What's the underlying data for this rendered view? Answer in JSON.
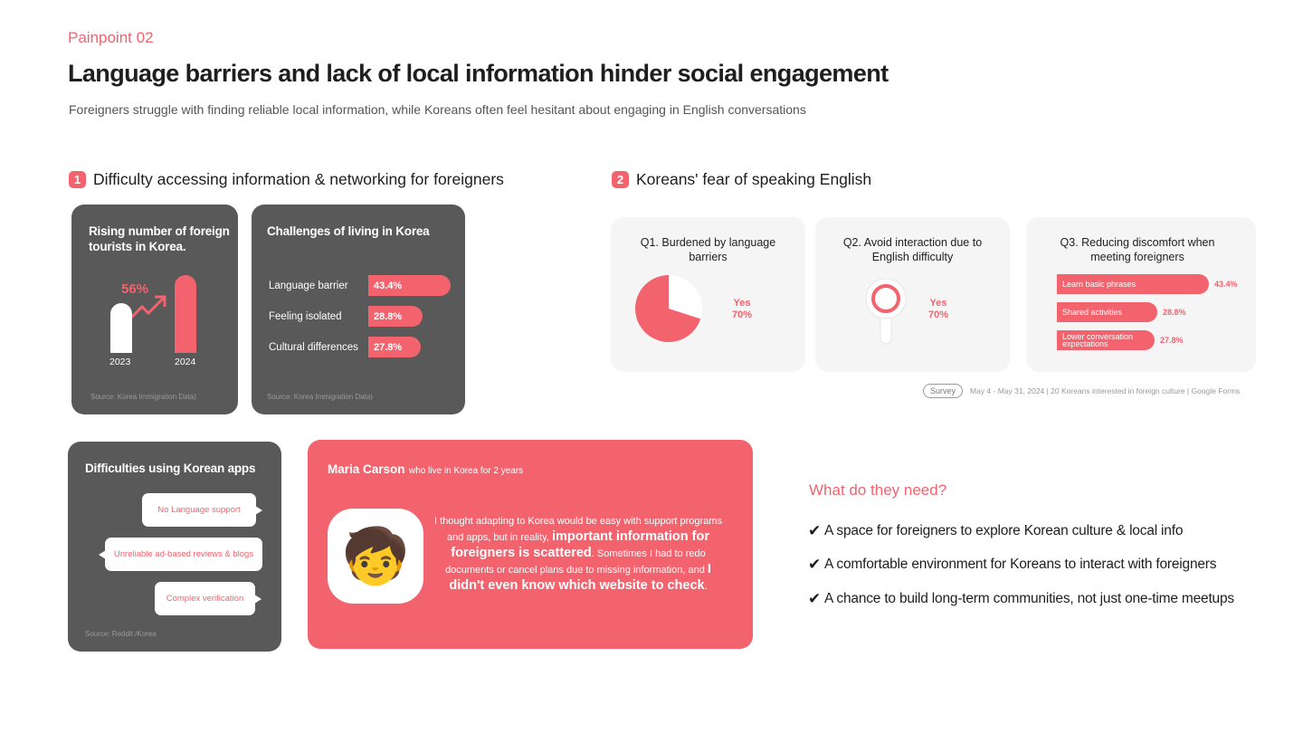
{
  "header": {
    "eyebrow": "Painpoint 02",
    "title": "Language barriers and lack of local information hinder social engagement",
    "subtitle": "Foreigners struggle with finding reliable local information, while Koreans often feel hesitant about engaging in English conversations"
  },
  "section1": {
    "number": "1",
    "title": "Difficulty accessing information & networking for foreigners",
    "tourists": {
      "title": "Rising number of foreign tourists in Korea.",
      "growth": "56%",
      "bars": [
        {
          "year": "2023",
          "value": 1.0
        },
        {
          "year": "2024",
          "value": 1.56
        }
      ],
      "source": "Source: Korea Immigration Data)"
    },
    "challenges": {
      "title": "Challenges of living in Korea",
      "rows": [
        {
          "label": "Language barrier",
          "pct": "43.4%",
          "value": 43.4
        },
        {
          "label": "Feeling isolated",
          "pct": "28.8%",
          "value": 28.8
        },
        {
          "label": "Cultural differences",
          "pct": "27.8%",
          "value": 27.8
        }
      ],
      "source": "Source: Korea Immigration Data)"
    }
  },
  "section2": {
    "number": "2",
    "title": "Koreans' fear of speaking English",
    "q1": {
      "title": "Q1. Burdened by language barriers",
      "yes_label": "Yes",
      "yes_pct": "70%",
      "value": 70
    },
    "q2": {
      "title": "Q2. Avoid interaction due to English difficulty",
      "yes_label": "Yes",
      "yes_pct": "70%",
      "value": 70
    },
    "q3": {
      "title": "Q3. Reducing discomfort when meeting foreigners",
      "rows": [
        {
          "label": "Learn basic phrases",
          "pct": "43.4%",
          "value": 43.4
        },
        {
          "label": "Shared activities",
          "pct": "28.8%",
          "value": 28.8
        },
        {
          "label": "Lower conversation expectations",
          "pct": "27.8%",
          "value": 27.8
        }
      ]
    },
    "survey_tag": "Survey",
    "survey_note": "May 4 - May 31, 2024 | 20 Koreans interested in foreign culture | Google Forms"
  },
  "apps": {
    "title": "Difficulties using Korean apps",
    "bubbles": [
      "No Language support",
      "Unreliable ad-based reviews & blogs",
      "Complex verification"
    ],
    "source": "Source: Reddit /Korea"
  },
  "quote": {
    "name": "Maria Carson",
    "role": "who live in Korea for 2 years",
    "avatar": "🧒",
    "p1": "I thought adapting to Korea would be easy with support programs and apps, but in reality,",
    "b1": "important information for foreigners is scattered",
    "p2": ". Sometimes I had to redo documents or cancel plans due to missing information, and",
    "b2": "I didn't even know which website to check",
    "p3": "."
  },
  "needs": {
    "title": "What do they need?",
    "check": "✔",
    "items": [
      "A space for foreigners to explore Korean culture & local info",
      "A comfortable environment for Koreans to interact with foreigners",
      "A chance to build long-term communities, not just one-time meetups"
    ]
  },
  "colors": {
    "accent": "#f2636e",
    "dark_card": "#595959",
    "light_card": "#f5f5f5"
  }
}
